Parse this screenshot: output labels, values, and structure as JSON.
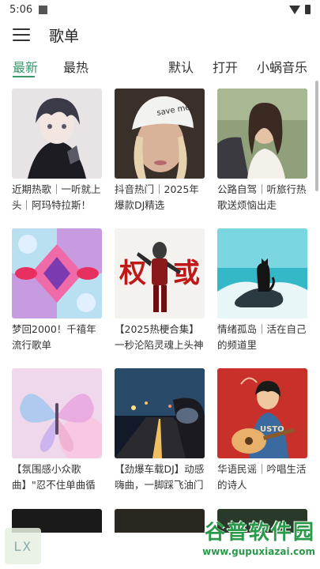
{
  "status_bar": {
    "time": "5:06"
  },
  "app_bar": {
    "title": "歌单"
  },
  "tabs": {
    "left": [
      {
        "label": "最新",
        "active": true
      },
      {
        "label": "最热",
        "active": false
      }
    ],
    "right": [
      {
        "label": "默认"
      },
      {
        "label": "打开"
      },
      {
        "label": "小蜗音乐"
      }
    ]
  },
  "playlists": [
    {
      "title": "近期热歌｜一听就上头｜阿玛特拉斯！",
      "icon": "anime-boy-cover"
    },
    {
      "title": "抖音热门｜2025年爆款DJ精选",
      "icon": "girl-white-cap-cover"
    },
    {
      "title": "公路自驾｜听旅行热歌送烦恼出走",
      "icon": "girl-car-cover"
    },
    {
      "title": "梦回2000！千禧年流行歌单",
      "icon": "kaleidoscope-cover"
    },
    {
      "title": "【2025热梗合集】一秒沦陷灵魂上头神曲",
      "icon": "hero-figure-cover"
    },
    {
      "title": "情绪孤岛｜活在自己的频道里",
      "icon": "cat-on-rock-cover"
    },
    {
      "title": "【氛围感小众歌曲】\"忍不住单曲循环",
      "icon": "butterfly-cover"
    },
    {
      "title": "【劲爆车载DJ】动感嗨曲，一脚踩飞油门",
      "icon": "car-mirror-cover"
    },
    {
      "title": "华语民谣｜吟唱生活的诗人",
      "icon": "guitar-singer-cover"
    }
  ],
  "overlay": {
    "lx_badge": "LX",
    "watermark_main": "谷普软件园",
    "watermark_url": "www.gupuxiazai.com"
  },
  "colors": {
    "accent": "#3a9a6a",
    "watermark": "#2a9a4a"
  }
}
